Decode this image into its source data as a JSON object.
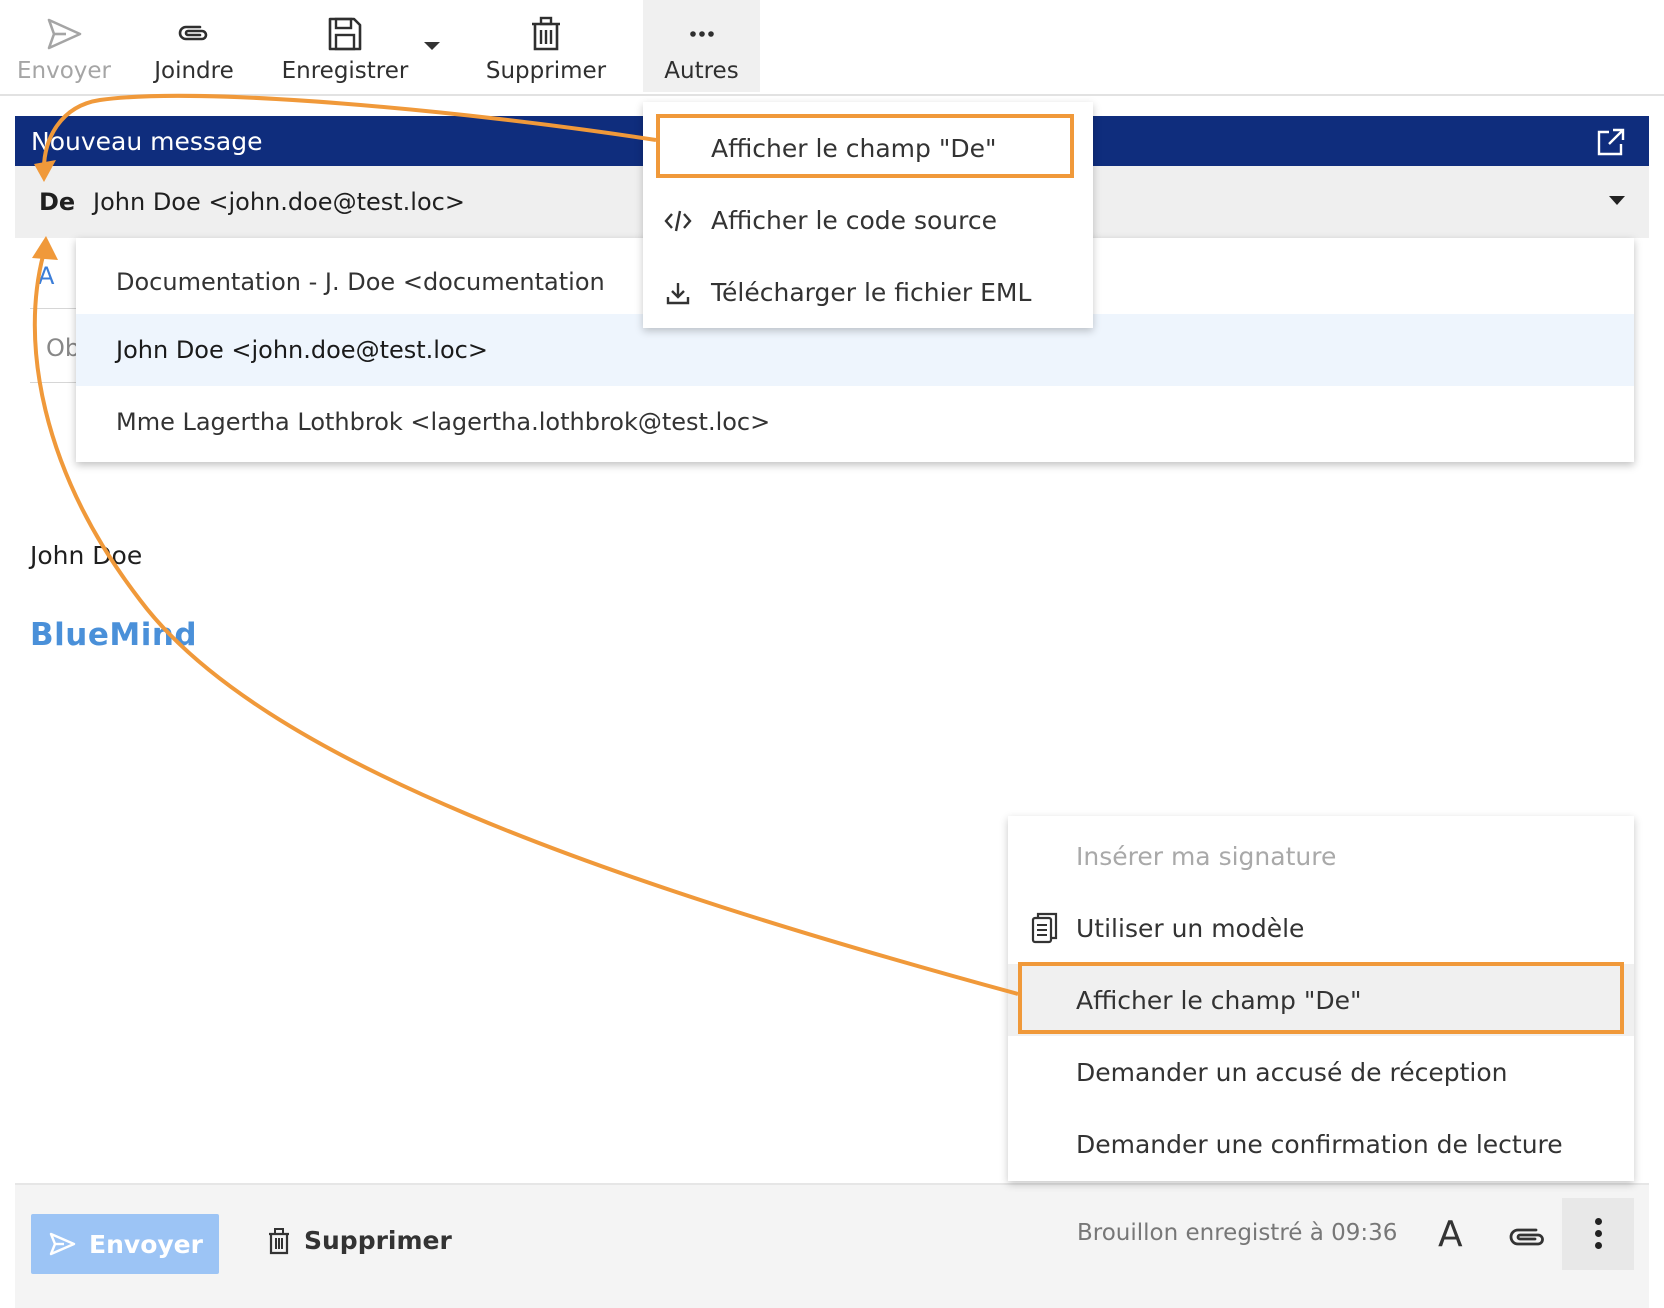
{
  "toolbar": {
    "send_label": "Envoyer",
    "attach_label": "Joindre",
    "save_label": "Enregistrer",
    "delete_label": "Supprimer",
    "more_label": "Autres"
  },
  "header": {
    "title": "Nouveau message"
  },
  "from": {
    "label": "De",
    "value": "John Doe <john.doe@test.loc>"
  },
  "to_label": "A",
  "subject_label": "Ob",
  "identities": [
    "Documentation - J. Doe <documentation",
    "John Doe <john.doe@test.loc>",
    "Mme Lagertha Lothbrok <lagertha.lothbrok@test.loc>"
  ],
  "more_menu": [
    "Afficher le champ \"De\"",
    "Afficher le code source",
    "Télécharger le fichier EML"
  ],
  "body": {
    "signature_name": "John Doe",
    "signature_logo": "BlueMind"
  },
  "kebab_menu": [
    "Insérer ma signature",
    "Utiliser un modèle",
    "Afficher le champ \"De\"",
    "Demander un accusé de réception",
    "Demander une confirmation de lecture"
  ],
  "footer": {
    "send_label": "Envoyer",
    "delete_label": "Supprimer",
    "draft_status": "Brouillon enregistré à 09:36",
    "format_glyph": "A"
  },
  "colors": {
    "header_bg": "#0f2d7d",
    "highlight": "#f0993a",
    "send_button": "#9cc4f5",
    "logo": "#4a90d9"
  }
}
